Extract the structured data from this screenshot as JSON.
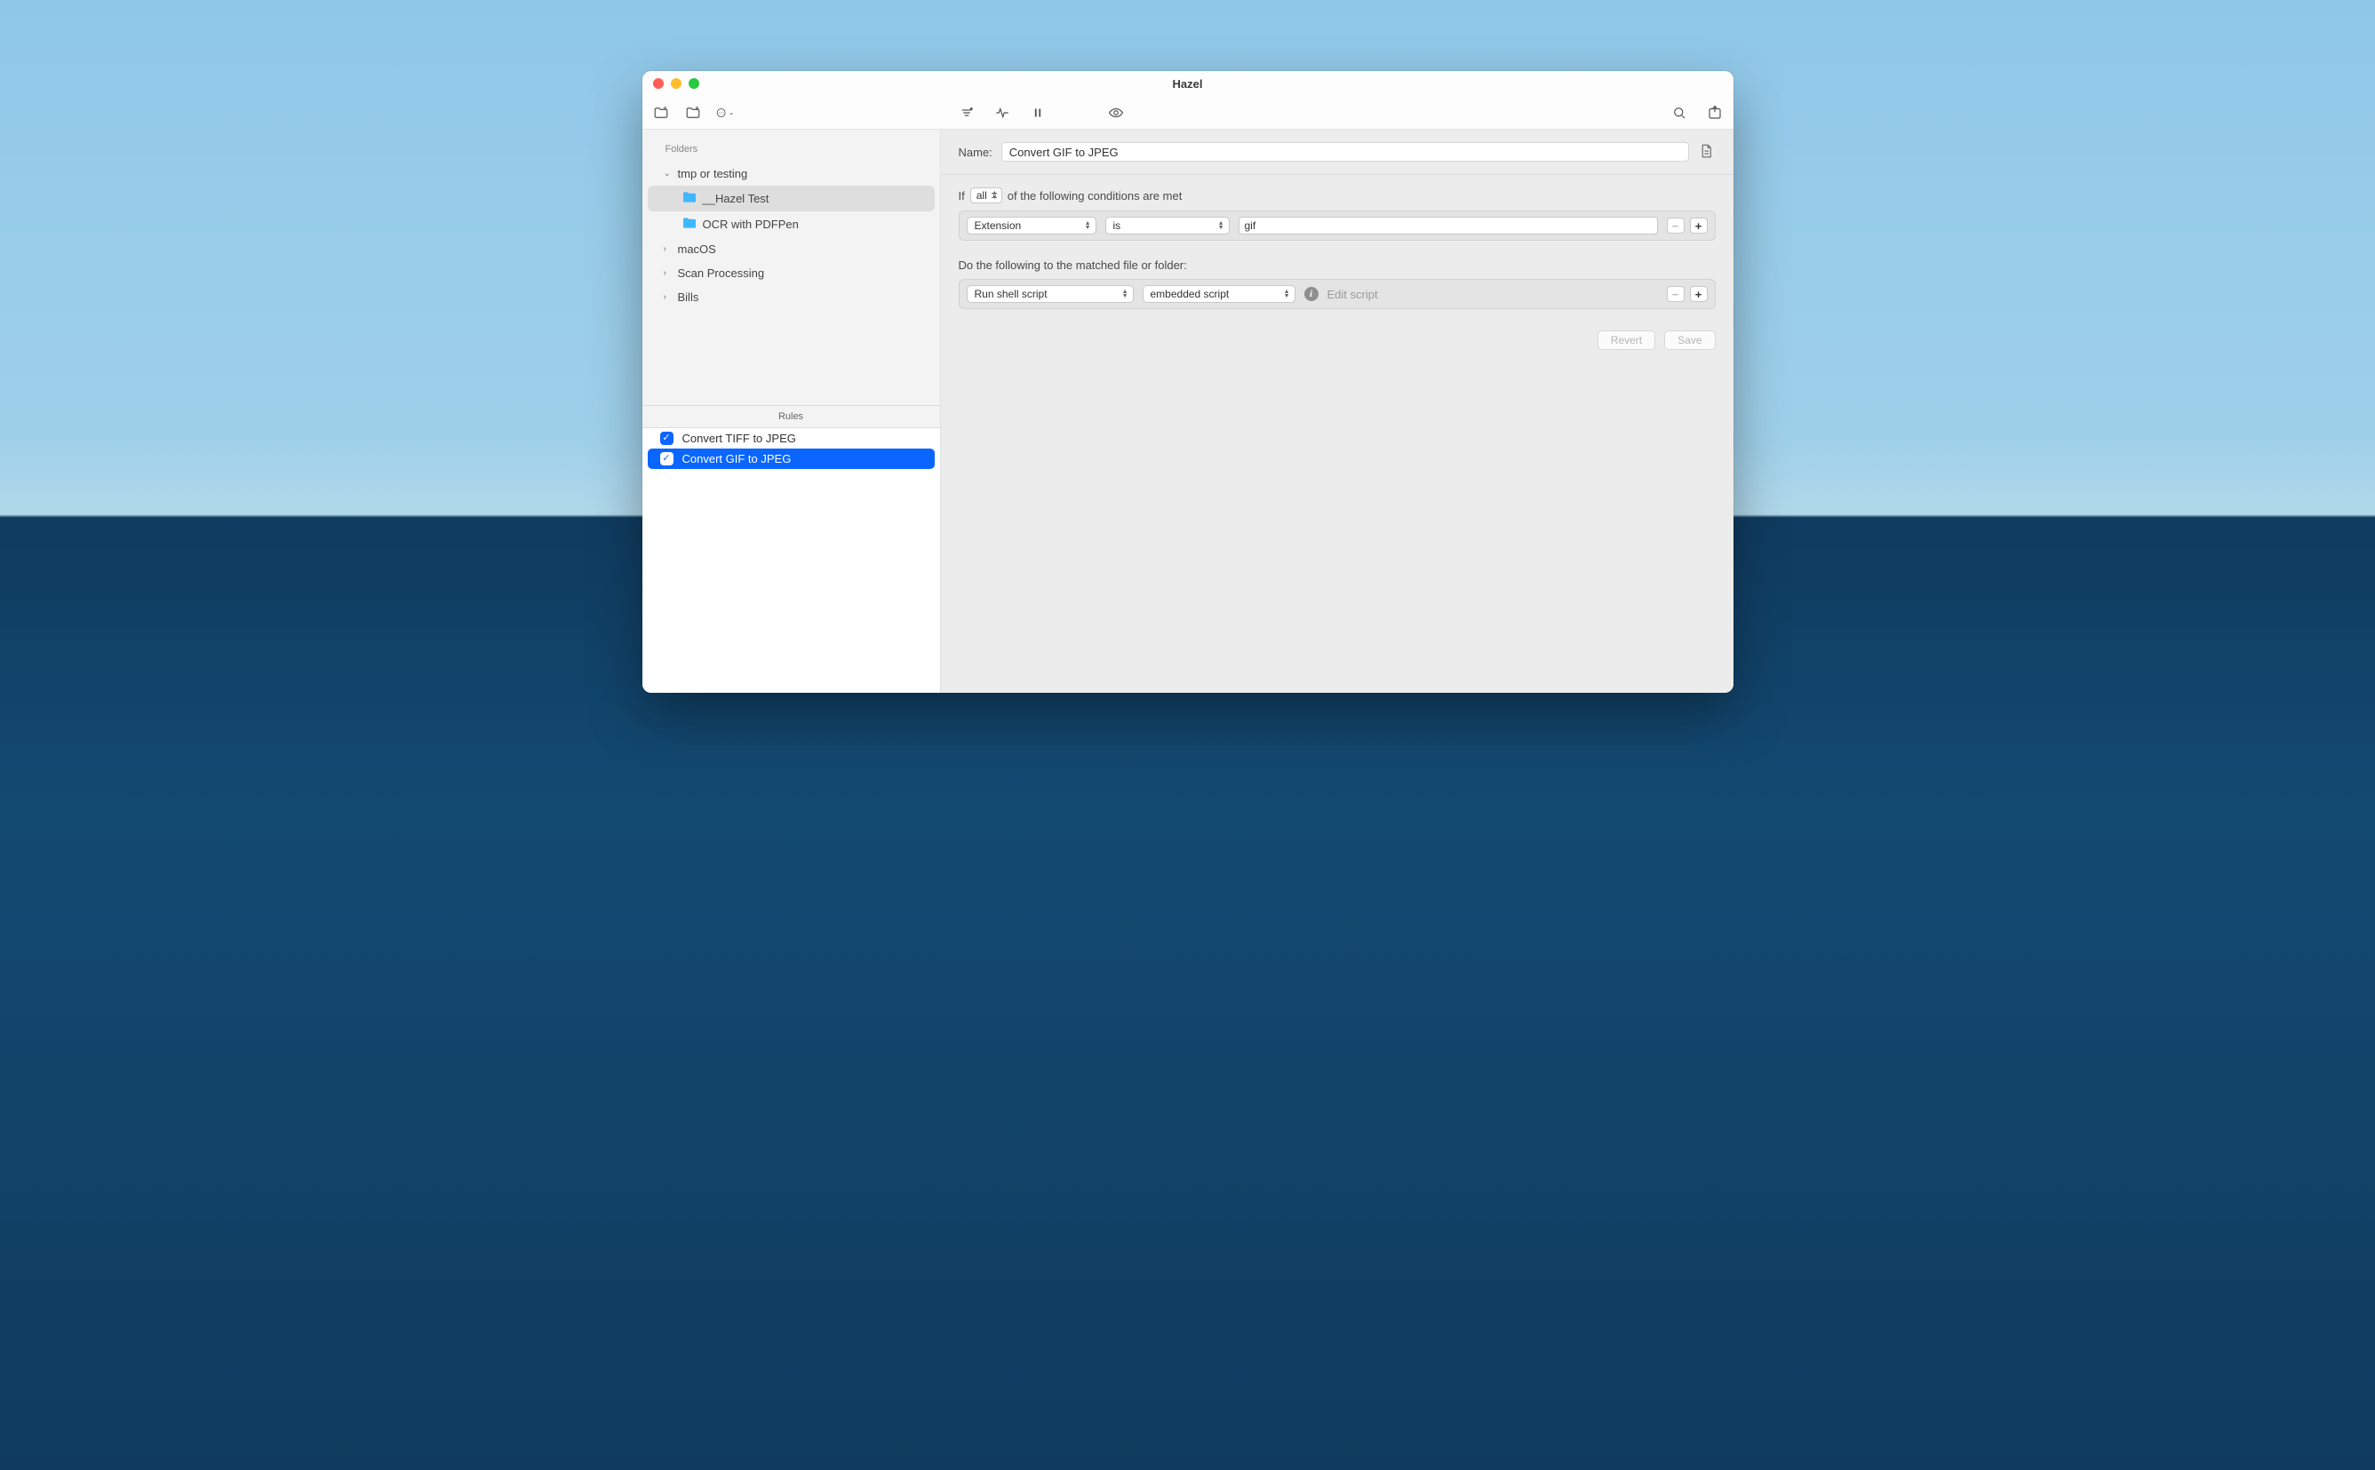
{
  "window": {
    "title": "Hazel"
  },
  "sidebar": {
    "folders_label": "Folders",
    "groups": [
      {
        "label": "tmp or testing",
        "expanded": true,
        "children": [
          {
            "label": "__Hazel Test",
            "selected": true
          },
          {
            "label": "OCR with PDFPen",
            "selected": false
          }
        ]
      },
      {
        "label": "macOS",
        "expanded": false
      },
      {
        "label": "Scan Processing",
        "expanded": false
      },
      {
        "label": "Bills",
        "expanded": false
      }
    ],
    "rules_label": "Rules",
    "rules": [
      {
        "label": "Convert TIFF to JPEG",
        "checked": true,
        "selected": false
      },
      {
        "label": "Convert GIF to JPEG",
        "checked": true,
        "selected": true
      }
    ]
  },
  "main": {
    "name_label": "Name:",
    "name_value": "Convert GIF to JPEG",
    "cond_prefix": "If",
    "cond_scope": "all",
    "cond_suffix": "of the following conditions are met",
    "condition": {
      "attribute": "Extension",
      "operator": "is",
      "value": "gif"
    },
    "action_intro": "Do the following to the matched file or folder:",
    "action": {
      "type": "Run shell script",
      "option": "embedded script",
      "edit_label": "Edit script"
    },
    "buttons": {
      "revert": "Revert",
      "save": "Save"
    }
  }
}
